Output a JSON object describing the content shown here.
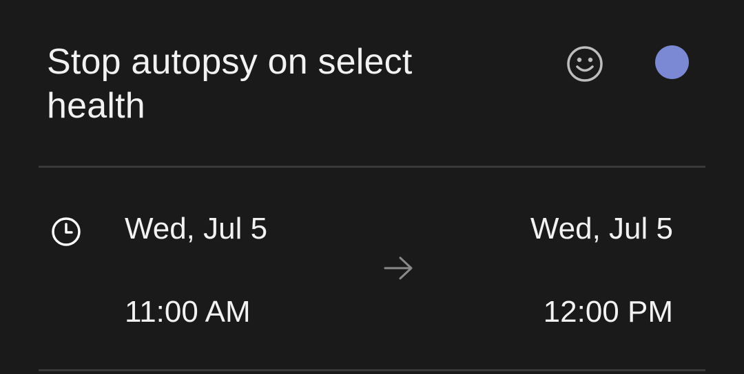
{
  "event": {
    "title": "Stop autopsy on select health",
    "color": "#7b88d3"
  },
  "icons": {
    "emoji": "smiley-face-icon",
    "clock": "clock-icon",
    "arrow": "arrow-right-icon"
  },
  "schedule": {
    "start_date": "Wed, Jul 5",
    "start_time": "11:00 AM",
    "end_date": "Wed, Jul 5",
    "end_time": "12:00 PM"
  }
}
